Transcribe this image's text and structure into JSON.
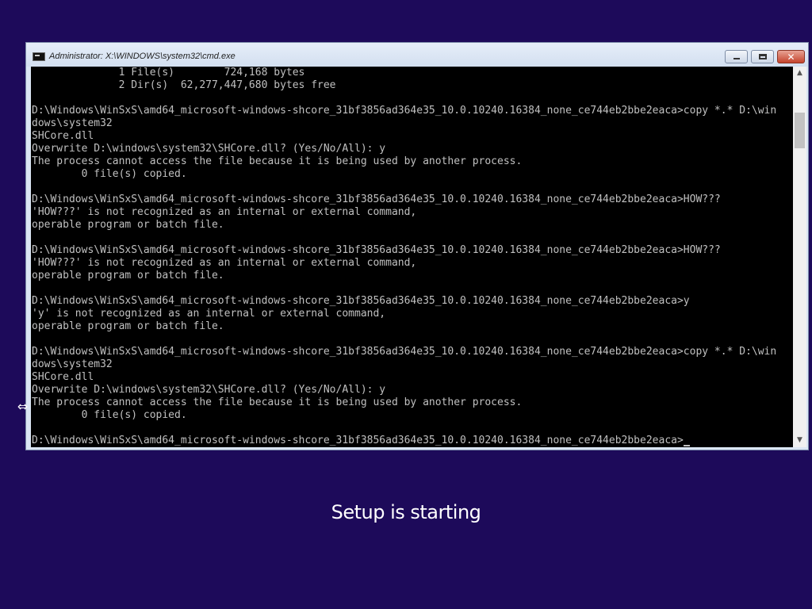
{
  "window": {
    "title": "Administrator: X:\\WINDOWS\\system32\\cmd.exe",
    "icon": "console-icon",
    "controls": {
      "minimize_icon": "minimize-icon",
      "maximize_icon": "maximize-icon",
      "close_icon": "close-icon",
      "close_glyph": "✕"
    }
  },
  "console": {
    "lines": [
      "              1 File(s)        724,168 bytes",
      "              2 Dir(s)  62,277,447,680 bytes free",
      "",
      "D:\\Windows\\WinSxS\\amd64_microsoft-windows-shcore_31bf3856ad364e35_10.0.10240.16384_none_ce744eb2bbe2eaca>copy *.* D:\\win",
      "dows\\system32",
      "SHCore.dll",
      "Overwrite D:\\windows\\system32\\SHCore.dll? (Yes/No/All): y",
      "The process cannot access the file because it is being used by another process.",
      "        0 file(s) copied.",
      "",
      "D:\\Windows\\WinSxS\\amd64_microsoft-windows-shcore_31bf3856ad364e35_10.0.10240.16384_none_ce744eb2bbe2eaca>HOW???",
      "'HOW???' is not recognized as an internal or external command,",
      "operable program or batch file.",
      "",
      "D:\\Windows\\WinSxS\\amd64_microsoft-windows-shcore_31bf3856ad364e35_10.0.10240.16384_none_ce744eb2bbe2eaca>HOW???",
      "'HOW???' is not recognized as an internal or external command,",
      "operable program or batch file.",
      "",
      "D:\\Windows\\WinSxS\\amd64_microsoft-windows-shcore_31bf3856ad364e35_10.0.10240.16384_none_ce744eb2bbe2eaca>y",
      "'y' is not recognized as an internal or external command,",
      "operable program or batch file.",
      "",
      "D:\\Windows\\WinSxS\\amd64_microsoft-windows-shcore_31bf3856ad364e35_10.0.10240.16384_none_ce744eb2bbe2eaca>copy *.* D:\\win",
      "dows\\system32",
      "SHCore.dll",
      "Overwrite D:\\windows\\system32\\SHCore.dll? (Yes/No/All): y",
      "The process cannot access the file because it is being used by another process.",
      "        0 file(s) copied.",
      ""
    ],
    "prompt": "D:\\Windows\\WinSxS\\amd64_microsoft-windows-shcore_31bf3856ad364e35_10.0.10240.16384_none_ce744eb2bbe2eaca>",
    "text_color": "#c0c0c0",
    "background_color": "#000000"
  },
  "scrollbar": {
    "up_glyph": "▲",
    "down_glyph": "▼"
  },
  "desktop": {
    "background_color": "#1d0a5a",
    "status_text": "Setup is starting",
    "pointer_glyph": "⇔"
  }
}
